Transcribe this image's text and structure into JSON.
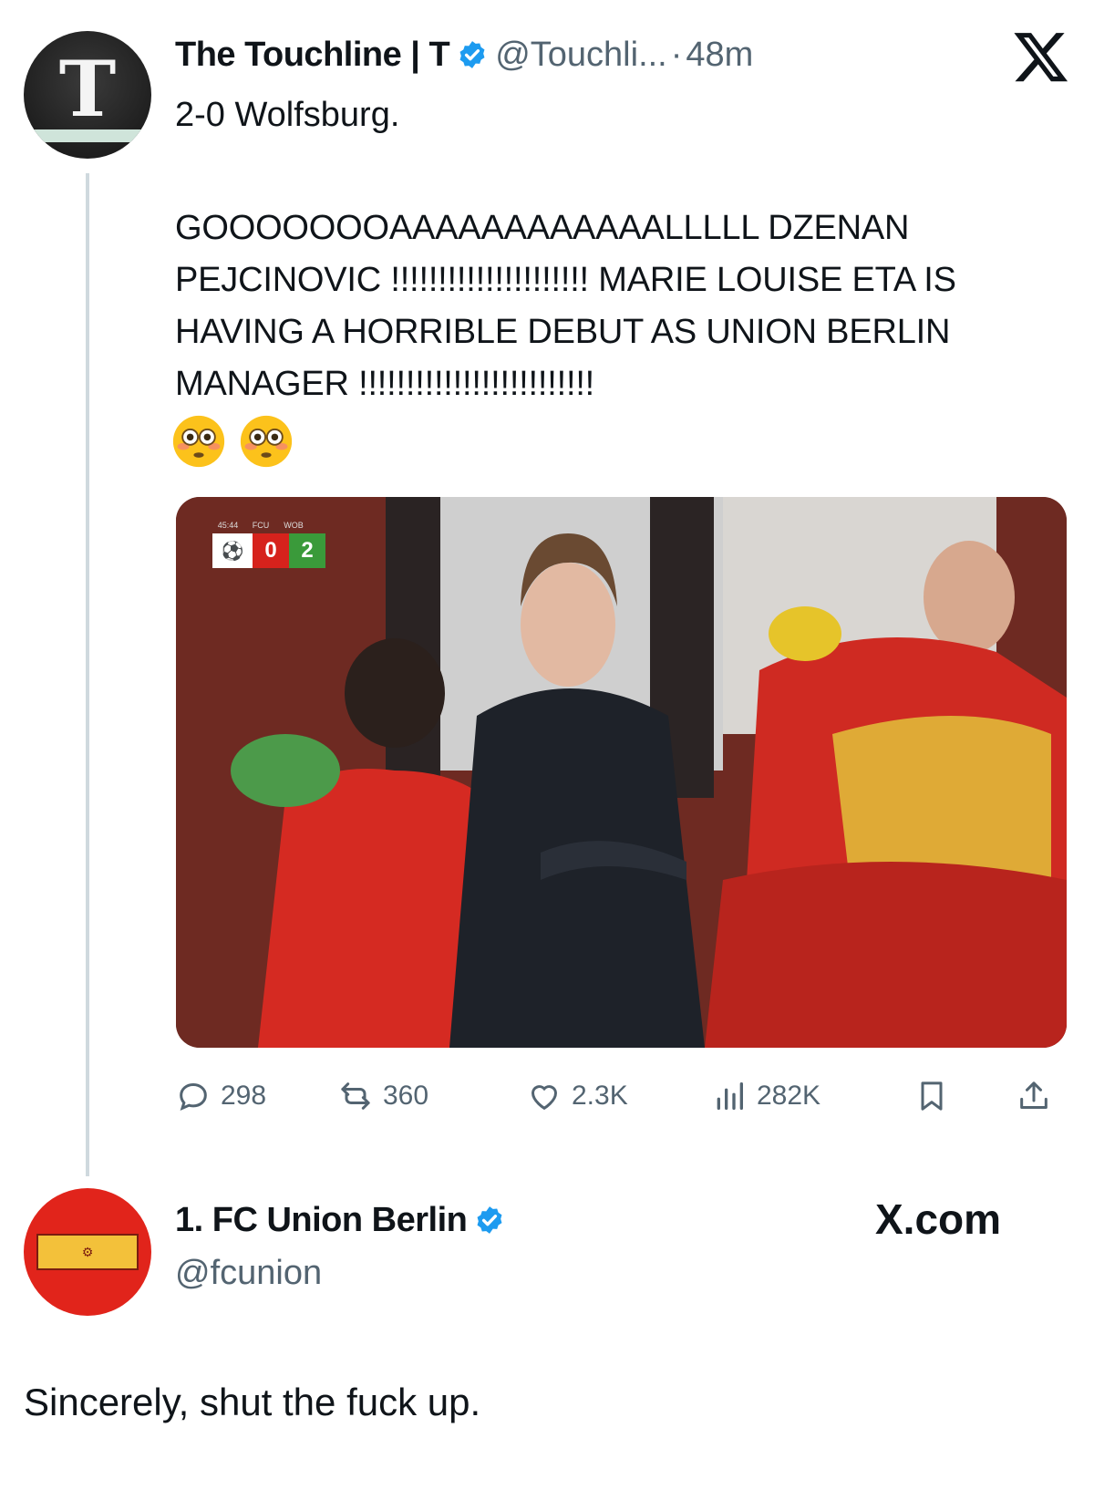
{
  "tweet": {
    "avatar_icon": "touchline-logo-icon",
    "avatar_letter": "T",
    "display_name": "The Touchline | T",
    "handle": "@Touchli...",
    "separator": "·",
    "time": "48m",
    "line1": "2-0 Wolfsburg.",
    "body": "GOOOOOOOAAAAAAAAAAAALLLLL DZENAN PEJCINOVIC !!!!!!!!!!!!!!!!!!!!! MARIE LOUISE ETA IS HAVING A HORRIBLE DEBUT AS UNION BERLIN MANAGER !!!!!!!!!!!!!!!!!!!!!!!!!",
    "emojis": [
      "flushed-face-icon",
      "flushed-face-icon"
    ],
    "media": {
      "scorebug": {
        "clock": "45:44",
        "home_abbr": "FCU",
        "away_abbr": "WOB",
        "home_score": "0",
        "away_score": "2"
      }
    },
    "stats": {
      "replies": "298",
      "reposts": "360",
      "likes": "2.3K",
      "views": "282K"
    }
  },
  "reply": {
    "display_name": "1. FC Union Berlin",
    "handle": "@fcunion",
    "site": "X.com",
    "text": "Sincerely, shut the fuck up.",
    "avatar_color": "#e1241b"
  },
  "colors": {
    "verified": "#1d9bf0",
    "muted": "#536471",
    "text": "#0f1419"
  }
}
